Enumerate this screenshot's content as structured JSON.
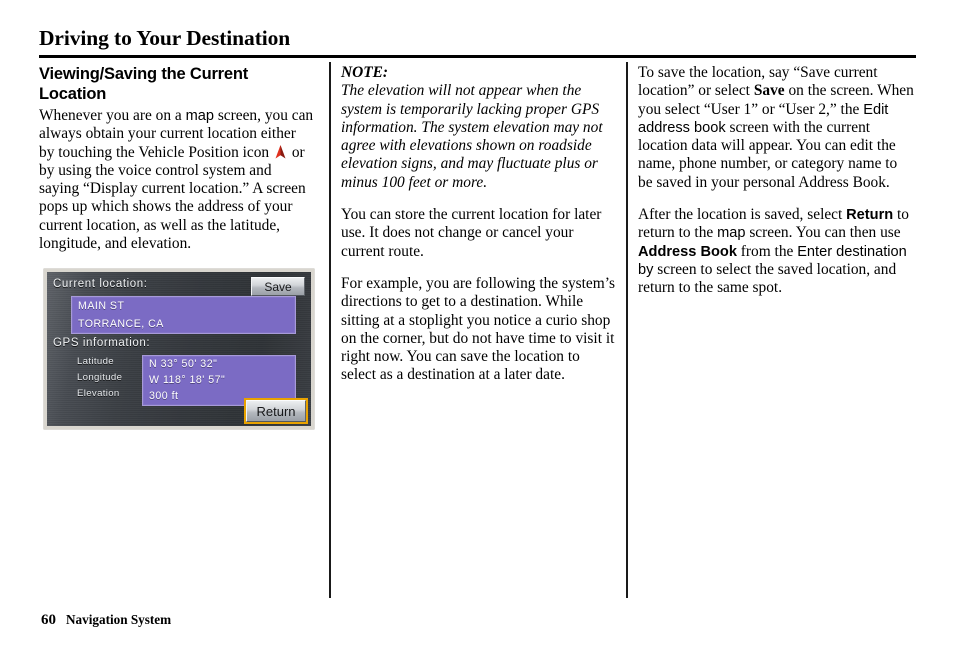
{
  "chapter": {
    "title": "Driving to Your Destination"
  },
  "column1": {
    "heading": "Viewing/Saving the Current Location",
    "paragraph_parts": {
      "p1_a": "Whenever you are on a ",
      "p1_map": "map",
      "p1_b": " screen, you can always obtain your current location either by touching the Vehicle Position icon ",
      "p1_icon": "vehicle-position-arrow",
      "p1_c": " or by using the voice control system and saying “Display current location.” A screen pops up which shows the address of your current location, as well as the latitude, longitude, and elevation."
    }
  },
  "nav_screen": {
    "current_location_label": "Current location:",
    "gps_information_label": "GPS information:",
    "address_line1": "MAIN ST",
    "address_line2": "TORRANCE, CA",
    "fields": [
      {
        "label": "Latitude",
        "value": "N 33° 50' 32\""
      },
      {
        "label": "Longitude",
        "value": "W 118° 18' 57\""
      },
      {
        "label": "Elevation",
        "value": "300 ft"
      }
    ],
    "save_button": "Save",
    "return_button": "Return",
    "colors": {
      "screen_background": "#3b3f44",
      "value_box": "#7b6bc4",
      "value_box_border": "#a79ad8",
      "button_face": "#d2d5d9",
      "return_highlight": "#e8a200",
      "frame": "#d9d6cf",
      "text": "#ffffff"
    }
  },
  "column2": {
    "note_label": "NOTE:",
    "note_text": "The elevation will not appear when the system is temporarily lacking proper GPS information. The system elevation may not agree with elevations shown on roadside elevation signs, and may fluctuate plus or minus 100 feet or more.",
    "paragraph2": "You can store the current location for later use. It does not change or cancel your current route.",
    "paragraph3": "For example, you are following the system’s directions to get to a destination. While sitting at a stoplight you notice a curio shop on the corner, but do not have time to visit it right now. You can save the location to select as a destination at a later date."
  },
  "column3": {
    "p1_a": "To save the location, say “Save current location” or select ",
    "p1_save": "Save",
    "p1_b": " on the screen. When you select “User 1” or “User 2,” the ",
    "p1_edit": "Edit address book",
    "p1_c": " screen with the current location data will appear. You can edit the name, phone number, or category name to be saved in your personal Address Book.",
    "p2_a": "After the location is saved, select ",
    "p2_return": "Return",
    "p2_b": " to return to the ",
    "p2_map": "map",
    "p2_c": " screen. You can then use ",
    "p2_addressbook": "Address Book",
    "p2_d": " from the ",
    "p2_enterdest": "Enter destination by",
    "p2_e": " screen to select the saved location, and return to the same spot."
  },
  "footer": {
    "page_number": "60",
    "section_name": "Navigation System"
  }
}
